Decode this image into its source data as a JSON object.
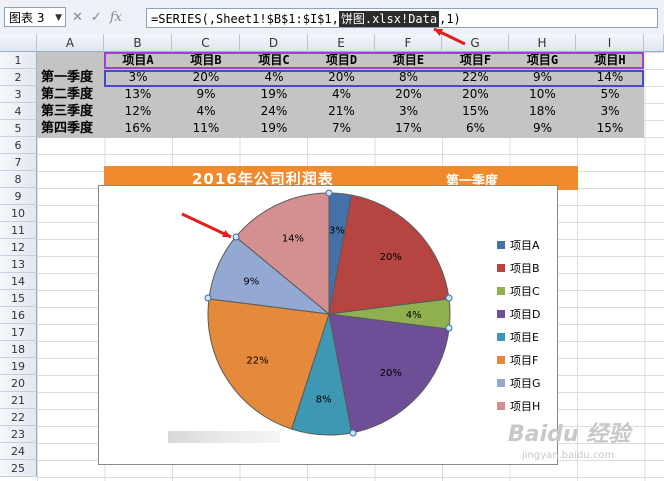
{
  "formula_bar": {
    "name_box": "图表 3",
    "icons": [
      "cancel-icon",
      "confirm-icon",
      "function-icon"
    ],
    "icon_glyphs": [
      "✕",
      "✓",
      "fx"
    ],
    "formula": "=SERIES(,Sheet1!$B$1:$I$1,饼图.xlsx!Data,1)",
    "formula_prefix": "=SERIES(,Sheet1!$B$1:$I$1,",
    "formula_selected": "饼图.xlsx!Data",
    "formula_suffix": ",1)"
  },
  "columns": [
    "A",
    "B",
    "C",
    "D",
    "E",
    "F",
    "G",
    "H",
    "I"
  ],
  "rows": [
    "1",
    "2",
    "3",
    "4",
    "5",
    "6",
    "7",
    "8",
    "9",
    "10",
    "11",
    "12",
    "13",
    "14",
    "15",
    "16",
    "17",
    "18",
    "19",
    "20",
    "21",
    "22",
    "23",
    "24",
    "25"
  ],
  "table": {
    "headers": [
      "项目A",
      "项目B",
      "项目C",
      "项目D",
      "项目E",
      "项目F",
      "项目G",
      "项目H"
    ],
    "row_labels": [
      "第一季度",
      "第二季度",
      "第三季度",
      "第四季度"
    ],
    "cells": [
      [
        "3%",
        "20%",
        "4%",
        "20%",
        "8%",
        "22%",
        "9%",
        "14%"
      ],
      [
        "13%",
        "9%",
        "19%",
        "4%",
        "20%",
        "20%",
        "10%",
        "5%"
      ],
      [
        "12%",
        "4%",
        "24%",
        "21%",
        "3%",
        "15%",
        "18%",
        "3%"
      ],
      [
        "16%",
        "11%",
        "19%",
        "7%",
        "17%",
        "6%",
        "9%",
        "15%"
      ]
    ]
  },
  "chart_title": "2016年公司利润表",
  "chart_subtitle": "第一季度",
  "chart_data": {
    "type": "pie",
    "categories": [
      "项目A",
      "项目B",
      "项目C",
      "项目D",
      "项目E",
      "项目F",
      "项目G",
      "项目H"
    ],
    "values": [
      3,
      20,
      4,
      20,
      8,
      22,
      9,
      14
    ],
    "labels": [
      "3%",
      "20%",
      "4%",
      "20%",
      "8%",
      "22%",
      "9%",
      "14%"
    ],
    "colors": [
      "#4472a8",
      "#b64542",
      "#90b050",
      "#6e4e96",
      "#3f98b3",
      "#e48a3a",
      "#93a9d3",
      "#d49090"
    ],
    "legend_placement": "right"
  },
  "watermark": "Baidu 经验",
  "watermark_sub": "jingyan.baidu.com"
}
